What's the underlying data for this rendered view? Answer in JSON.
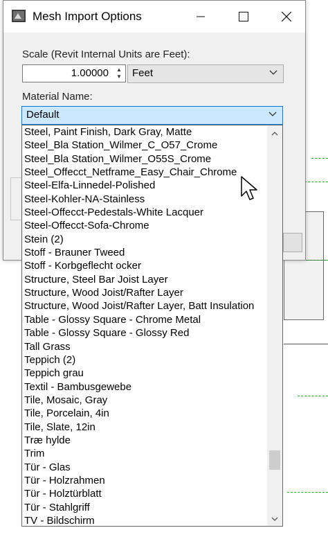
{
  "window": {
    "title": "Mesh Import Options",
    "minimize_icon": "minimize-icon",
    "maximize_icon": "maximize-icon",
    "close_icon": "close-icon"
  },
  "scale": {
    "label": "Scale (Revit Internal Units are Feet):",
    "value": "1.00000",
    "unit": "Feet"
  },
  "material": {
    "label": "Material Name:",
    "selected": "Default"
  },
  "dropdown_items": [
    "Steel, Paint Finish, Dark Gray, Matte",
    "Steel_Bla Station_Wilmer_C_O57_Crome",
    "Steel_Bla Station_Wilmer_O55S_Crome",
    "Steel_Offecct_Netframe_Easy_Chair_Chrome",
    "Steel-Elfa-Linnedel-Polished",
    "Steel-Kohler-NA-Stainless",
    "Steel-Offecct-Pedestals-White Lacquer",
    "Steel-Offecct-Sofa-Chrome",
    "Stein (2)",
    "Stoff - Brauner Tweed",
    "Stoff - Korbgeflecht ocker",
    "Structure, Steel Bar Joist Layer",
    "Structure, Wood Joist/Rafter Layer",
    "Structure, Wood Joist/Rafter Layer, Batt Insulation",
    "Table - Glossy Square - Chrome Metal",
    "Table - Glossy Square - Glossy Red",
    "Tall Grass",
    "Teppich (2)",
    "Teppich grau",
    "Textil - Bambusgewebe",
    "Tile, Mosaic, Gray",
    "Tile, Porcelain, 4in",
    "Tile, Slate, 12in",
    "Træ hylde",
    "Trim",
    "Tür - Glas",
    "Tür - Holzrahmen",
    "Tür - Holztürblatt",
    "Tür - Stahlgriff",
    "TV - Bildschirm"
  ],
  "scrollbar": {
    "position_fraction": 0.88
  },
  "colors": {
    "selection": "#cce8ff",
    "focus_border": "#0078d7",
    "guide_lines": "#1fa51f"
  }
}
